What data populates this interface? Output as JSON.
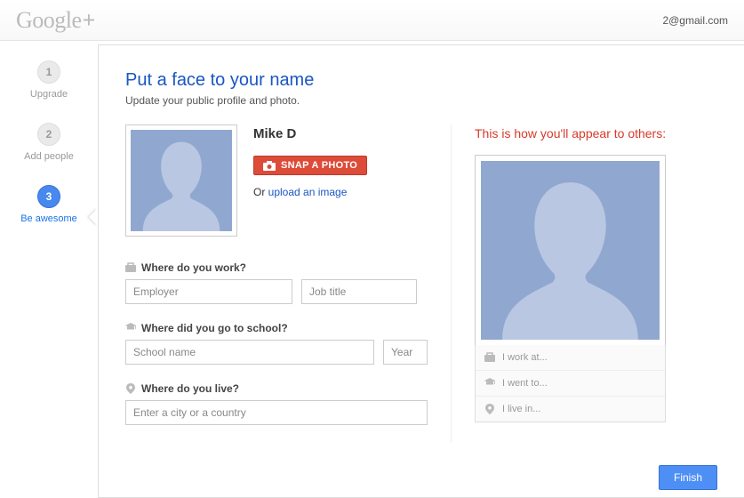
{
  "header": {
    "logo_text": "Google",
    "logo_plus": "+",
    "user_email": "2@gmail.com"
  },
  "steps": [
    {
      "number": "1",
      "label": "Upgrade"
    },
    {
      "number": "2",
      "label": "Add people"
    },
    {
      "number": "3",
      "label": "Be awesome"
    }
  ],
  "title": "Put a face to your name",
  "subtitle": "Update your public profile and photo.",
  "profile": {
    "name": "Mike D",
    "snap_label": "SNAP A PHOTO",
    "or_text": "Or ",
    "upload_link": "upload an image"
  },
  "fields": {
    "work": {
      "label": "Where do you work?",
      "employer_placeholder": "Employer",
      "job_placeholder": "Job title"
    },
    "school": {
      "label": "Where did you go to school?",
      "school_placeholder": "School name",
      "year_placeholder": "Year"
    },
    "live": {
      "label": "Where do you live?",
      "city_placeholder": "Enter a city or a country"
    }
  },
  "preview": {
    "heading": "This is how you'll appear to others:",
    "work": "I work at...",
    "school": "I went to...",
    "live": "I live in..."
  },
  "finish_label": "Finish"
}
